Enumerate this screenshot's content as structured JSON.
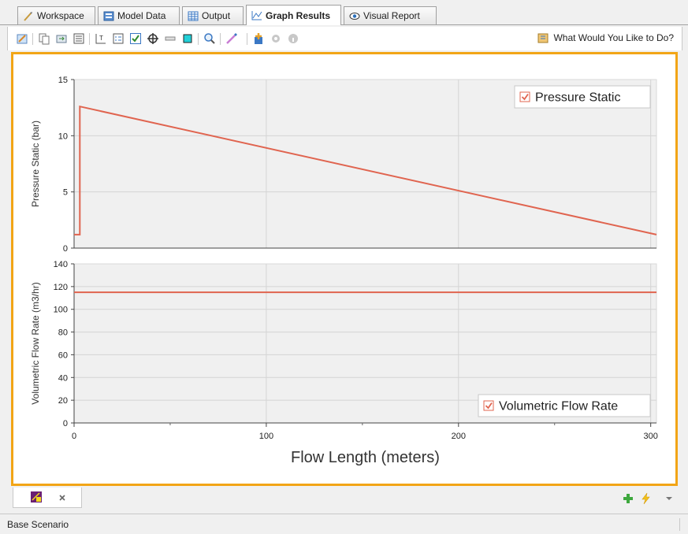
{
  "tabs": [
    {
      "label": "Workspace",
      "icon": "workspace-icon"
    },
    {
      "label": "Model Data",
      "icon": "model-data-icon"
    },
    {
      "label": "Output",
      "icon": "output-icon"
    },
    {
      "label": "Graph Results",
      "icon": "graph-results-icon"
    },
    {
      "label": "Visual Report",
      "icon": "eye-icon"
    }
  ],
  "active_tab": "Graph Results",
  "toolbar": {
    "help_label": "What Would You Like to Do?",
    "buttons": [
      "edit-graph-icon",
      "copy-icon",
      "export-icon",
      "list-icon",
      "axis-text-icon",
      "legend-icon",
      "checkbox-icon",
      "crosshair-icon",
      "minus-bar-icon",
      "cyan-square-icon",
      "zoom-icon",
      "pen-icon",
      "add-plot-icon",
      "gear-icon",
      "info-icon"
    ]
  },
  "status_bar": {
    "scenario": "Base Scenario"
  },
  "colors": {
    "series": "#e0644f",
    "frame": "#f2a516",
    "plot_bg": "#f0f0f0",
    "grid": "#d4d4d4"
  },
  "chart_data": [
    {
      "type": "line",
      "title": "",
      "ylabel": "Pressure Static (bar)",
      "xlabel": "",
      "xlim": [
        0,
        303
      ],
      "ylim": [
        0,
        15
      ],
      "yticks": [
        0,
        5,
        10,
        15
      ],
      "grid": true,
      "legend": "top-right",
      "series": [
        {
          "name": "Pressure Static",
          "x": [
            0,
            3,
            3,
            303
          ],
          "y": [
            1.2,
            1.2,
            12.6,
            1.2
          ]
        }
      ]
    },
    {
      "type": "line",
      "title": "",
      "ylabel": "Volumetric Flow Rate (m3/hr)",
      "xlabel": "Flow Length (meters)",
      "xlim": [
        0,
        303
      ],
      "ylim": [
        0,
        140
      ],
      "yticks": [
        0,
        20,
        40,
        60,
        80,
        100,
        120,
        140
      ],
      "xticks": [
        0,
        100,
        200,
        300
      ],
      "grid": true,
      "legend": "bottom-right",
      "series": [
        {
          "name": "Volumetric Flow Rate",
          "x": [
            0,
            303
          ],
          "y": [
            115,
            115
          ]
        }
      ]
    }
  ]
}
